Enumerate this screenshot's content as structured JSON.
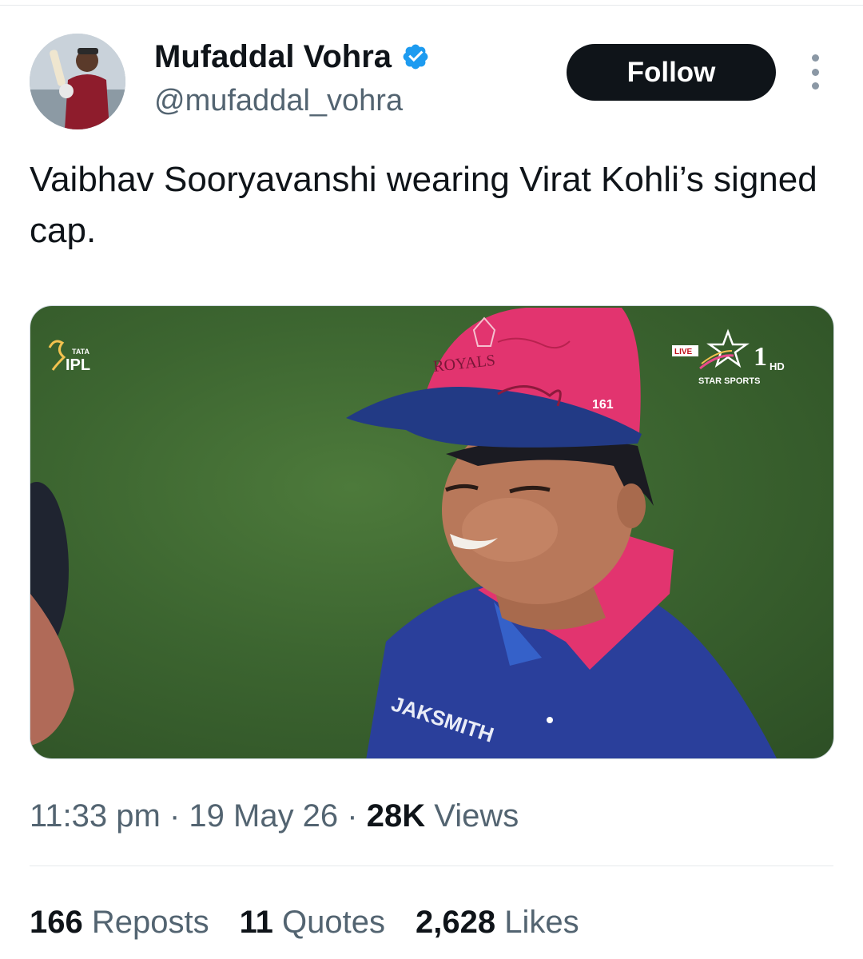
{
  "author": {
    "display_name": "Mufaddal Vohra",
    "handle": "@mufaddal_vohra",
    "avatar_icon": "profile-photo",
    "verified_icon": "verified-badge-icon"
  },
  "actions": {
    "follow_label": "Follow",
    "more_icon": "more-options-icon"
  },
  "tweet": {
    "text": "Vaibhav Sooryavanshi wearing Virat Kohli’s signed cap."
  },
  "media": {
    "broadcast_logo_left": "IPL",
    "broadcast_logo_left_small": "TATA",
    "live_badge": "LIVE",
    "channel_number": "1",
    "channel_hd": "HD",
    "channel_name": "STAR SPORTS",
    "cap_team": "ROYALS",
    "cap_number": "161",
    "jersey_sponsor": "JAKSMITH"
  },
  "meta": {
    "time": "11:33 pm",
    "date": "19 May 26",
    "views_count": "28K",
    "views_label": "Views",
    "separator": "·"
  },
  "stats": {
    "reposts_count": "166",
    "reposts_label": "Reposts",
    "quotes_count": "11",
    "quotes_label": "Quotes",
    "likes_count": "2,628",
    "likes_label": "Likes"
  },
  "colors": {
    "text_primary": "#0f1419",
    "text_secondary": "#536471",
    "verified_blue": "#1d9bf0",
    "divider": "#e6e9ec",
    "cap_pink": "#e2346f",
    "jersey_blue": "#2a3f9b"
  }
}
